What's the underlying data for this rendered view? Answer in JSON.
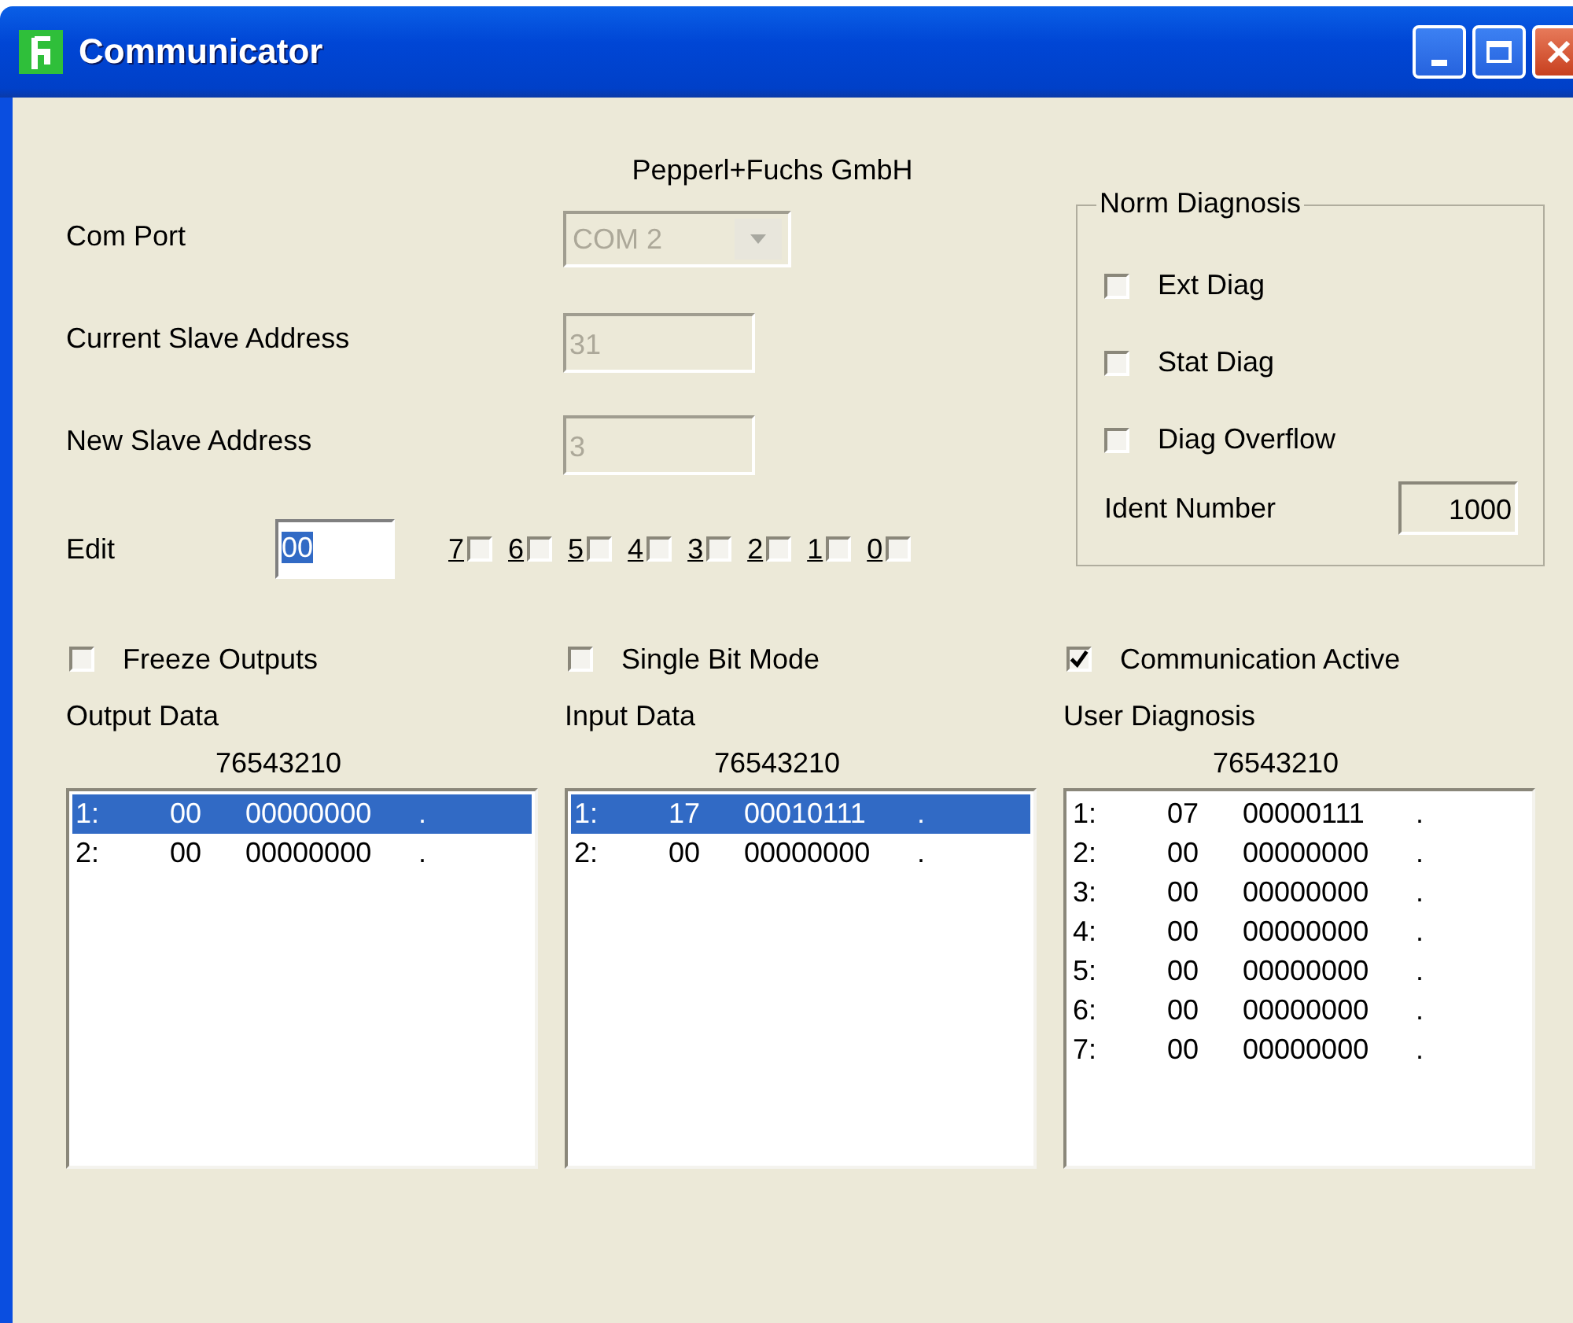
{
  "window": {
    "title": "Communicator"
  },
  "company": "Pepperl+Fuchs GmbH",
  "fields": [
    {
      "kind": "combo",
      "label": "Com Port",
      "value": "COM 2",
      "disabled": true
    },
    {
      "kind": "text",
      "label": "Current Slave Address",
      "value": "31",
      "disabled": true
    },
    {
      "kind": "text",
      "label": "New Slave Address",
      "value": "3",
      "disabled": true
    }
  ],
  "edit": {
    "label": "Edit",
    "value": "00",
    "bits": [
      {
        "label": "7",
        "checked": false
      },
      {
        "label": "6",
        "checked": false
      },
      {
        "label": "5",
        "checked": false
      },
      {
        "label": "4",
        "checked": false
      },
      {
        "label": "3",
        "checked": false
      },
      {
        "label": "2",
        "checked": false
      },
      {
        "label": "1",
        "checked": false
      },
      {
        "label": "0",
        "checked": false
      }
    ]
  },
  "norm_diagnosis": {
    "title": "Norm Diagnosis",
    "options": [
      {
        "label": "Ext Diag",
        "checked": false
      },
      {
        "label": "Stat Diag",
        "checked": false
      },
      {
        "label": "Diag Overflow",
        "checked": false
      }
    ],
    "ident_label": "Ident Number",
    "ident_value": "1000"
  },
  "options": [
    {
      "label": "Freeze Outputs",
      "checked": false
    },
    {
      "label": "Single Bit Mode",
      "checked": false
    },
    {
      "label": "Communication Active",
      "checked": true
    }
  ],
  "panels": [
    {
      "title": "Output Data",
      "header": "76543210",
      "rows": [
        {
          "index": "1:",
          "hex": "00",
          "bits": "00000000",
          "mark": ".",
          "selected": true
        },
        {
          "index": "2:",
          "hex": "00",
          "bits": "00000000",
          "mark": ".",
          "selected": false
        }
      ]
    },
    {
      "title": "Input Data",
      "header": "76543210",
      "rows": [
        {
          "index": "1:",
          "hex": "17",
          "bits": "00010111",
          "mark": ".",
          "selected": true
        },
        {
          "index": "2:",
          "hex": "00",
          "bits": "00000000",
          "mark": ".",
          "selected": false
        }
      ]
    },
    {
      "title": "User Diagnosis",
      "header": "76543210",
      "rows": [
        {
          "index": "1:",
          "hex": "07",
          "bits": "00000111",
          "mark": ".",
          "selected": false
        },
        {
          "index": "2:",
          "hex": "00",
          "bits": "00000000",
          "mark": ".",
          "selected": false
        },
        {
          "index": "3:",
          "hex": "00",
          "bits": "00000000",
          "mark": ".",
          "selected": false
        },
        {
          "index": "4:",
          "hex": "00",
          "bits": "00000000",
          "mark": ".",
          "selected": false
        },
        {
          "index": "5:",
          "hex": "00",
          "bits": "00000000",
          "mark": ".",
          "selected": false
        },
        {
          "index": "6:",
          "hex": "00",
          "bits": "00000000",
          "mark": ".",
          "selected": false
        },
        {
          "index": "7:",
          "hex": "00",
          "bits": "00000000",
          "mark": ".",
          "selected": false
        }
      ]
    }
  ]
}
